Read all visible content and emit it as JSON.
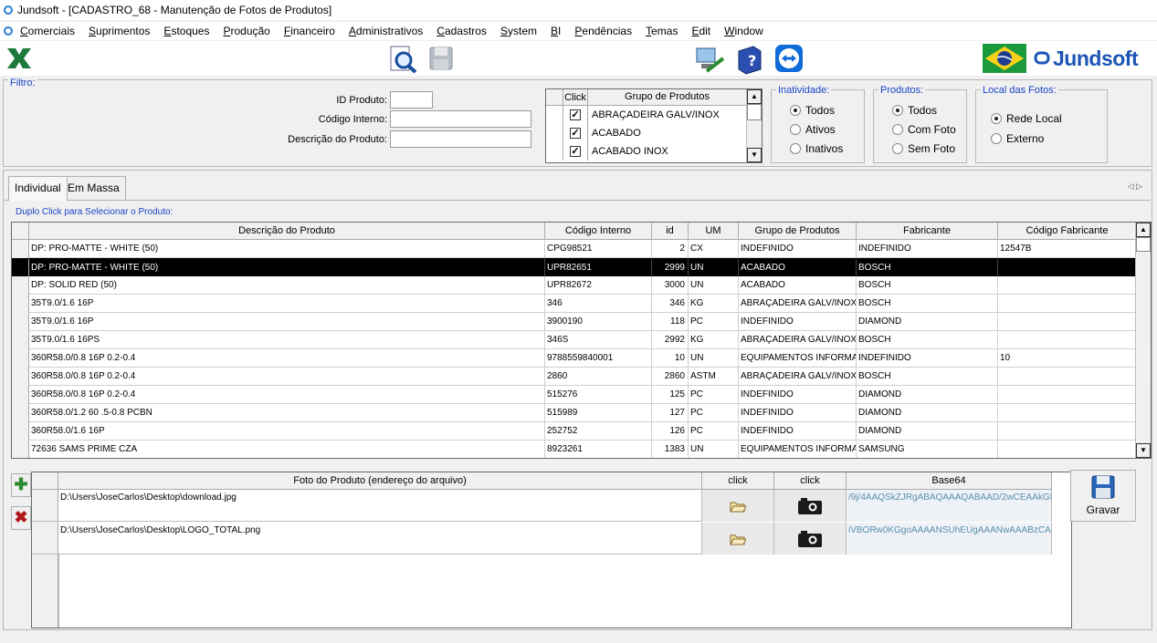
{
  "window": {
    "title": "Jundsoft - [CADASTRO_68 - Manutenção de Fotos de Produtos]"
  },
  "menu": [
    "Comerciais",
    "Suprimentos",
    "Estoques",
    "Produção",
    "Financeiro",
    "Administrativos",
    "Cadastros",
    "System",
    "BI",
    "Pendências",
    "Temas",
    "Edit",
    "Window"
  ],
  "toolbar": {
    "logo_text": "Jundsoft"
  },
  "filter": {
    "legend": "Filtro:",
    "id_label": "ID Produto:",
    "codigo_label": "Código Interno:",
    "descricao_label": "Descrição do Produto:",
    "group_table": {
      "headers": [
        "Click",
        "Grupo de Produtos"
      ],
      "rows": [
        "ABRAÇADEIRA GALV/INOX",
        "ACABADO",
        "ACABADO INOX"
      ]
    },
    "inatividade": {
      "legend": "Inatividade:",
      "options": [
        "Todos",
        "Ativos",
        "Inativos"
      ],
      "selected": "Todos"
    },
    "produtos": {
      "legend": "Produtos:",
      "options": [
        "Todos",
        "Com Foto",
        "Sem Foto"
      ],
      "selected": "Todos"
    },
    "local": {
      "legend": "Local das Fotos:",
      "options": [
        "Rede Local",
        "Externo"
      ],
      "selected": "Rede Local"
    }
  },
  "tabs": [
    "Individual",
    "Em Massa"
  ],
  "hint": "Duplo Click para Selecionar o Produto:",
  "products": {
    "headers": [
      "Descrição do Produto",
      "Código Interno",
      "id",
      "UM",
      "Grupo de Produtos",
      "Fabricante",
      "Código Fabricante"
    ],
    "rows": [
      [
        " DP: PRO-MATTE - WHITE (50)",
        "CPG98521",
        "2",
        "CX",
        "INDEFINIDO",
        "INDEFINIDO",
        "12547B"
      ],
      [
        " DP: PRO-MATTE - WHITE (50)",
        "UPR82651",
        "2999",
        "UN",
        "ACABADO",
        "BOSCH",
        ""
      ],
      [
        " DP: SOLID RED (50)",
        "UPR82672",
        "3000",
        "UN",
        "ACABADO",
        "BOSCH",
        ""
      ],
      [
        "35T9.0/1.6 16P",
        "346",
        "346",
        "KG",
        "ABRAÇADEIRA GALV/INOX",
        "BOSCH",
        ""
      ],
      [
        "35T9.0/1.6 16P",
        "3900190",
        "118",
        "PC",
        "INDEFINIDO",
        "DIAMOND",
        ""
      ],
      [
        "35T9.0/1.6 16PS",
        "346S",
        "2992",
        "KG",
        "ABRAÇADEIRA GALV/INOX",
        "BOSCH",
        ""
      ],
      [
        "360R58.0/0.8 16P 0.2-0.4",
        "9788559840001",
        "10",
        "UN",
        "EQUIPAMENTOS INFORMATICA",
        "INDEFINIDO",
        "10"
      ],
      [
        "360R58.0/0.8 16P 0.2-0.4",
        "2860",
        "2860",
        "ASTM",
        "ABRAÇADEIRA GALV/INOX",
        "BOSCH",
        ""
      ],
      [
        "360R58.0/0.8 16P 0.2-0.4",
        "515276",
        "125",
        "PC",
        "INDEFINIDO",
        "DIAMOND",
        ""
      ],
      [
        "360R58.0/1.2 60 .5-0.8 PCBN",
        "515989",
        "127",
        "PC",
        "INDEFINIDO",
        "DIAMOND",
        ""
      ],
      [
        "360R58.0/1.6 16P",
        "252752",
        "126",
        "PC",
        "INDEFINIDO",
        "DIAMOND",
        ""
      ],
      [
        "72636 SAMS PRIME CZA",
        "8923261",
        "1383",
        "UN",
        "EQUIPAMENTOS INFORMATICA",
        "SAMSUNG",
        ""
      ]
    ],
    "selected_index": 1
  },
  "photos": {
    "headers": [
      "Foto do Produto (endereço do arquivo)",
      "click",
      "click",
      "Base64"
    ],
    "rows": [
      {
        "path": "D:\\Users\\JoseCarlos\\Desktop\\download.jpg",
        "base64": "/9j/4AAQSkZJRgABAQAAAQABAAD/2wCEAAkGB..."
      },
      {
        "path": "D:\\Users\\JoseCarlos\\Desktop\\LOGO_TOTAL.png",
        "base64": "iVBORw0KGgoAAAANSUhEUgAAANwAAABzCA..."
      }
    ]
  },
  "save_label": "Gravar"
}
